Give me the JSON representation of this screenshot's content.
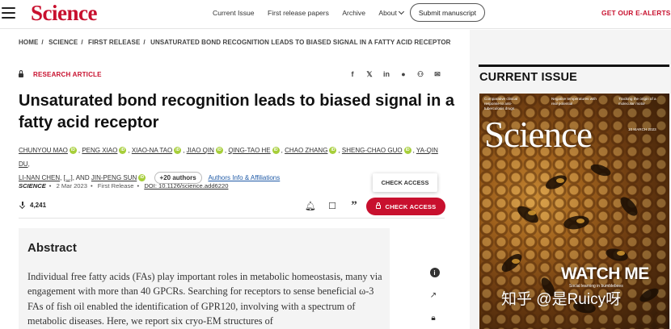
{
  "header": {
    "logo": "Science",
    "nav": [
      "Current Issue",
      "First release papers",
      "Archive",
      "About"
    ],
    "submit_label": "Submit manuscript",
    "ealerts_label": "GET OUR E-ALERTS"
  },
  "breadcrumb": [
    "HOME",
    "SCIENCE",
    "FIRST RELEASE",
    "UNSATURATED BOND RECOGNITION LEADS TO BIASED SIGNAL IN A FATTY ACID RECEPTOR"
  ],
  "article": {
    "type_label": "RESEARCH ARTICLE",
    "title": "Unsaturated bond recognition leads to biased signal in a fatty acid receptor",
    "authors": [
      "CHUNYOU MAO",
      "PENG XIAO",
      "XIAO-NA TAO",
      "JIAO QIN",
      "QING-TAO HE",
      "CHAO ZHANG",
      "SHENG-CHAO GUO",
      "YA-QIN DU",
      "LI-NAN CHEN"
    ],
    "authors_ellipsis": "[...]",
    "authors_and": ", AND",
    "last_author": "JIN-PENG SUN",
    "more_authors": "+20 authors",
    "affiliations_link": "Authors Info & Affiliations",
    "journal": "SCIENCE",
    "date": "2 Mar 2023",
    "release": "First Release",
    "doi": "DOI: 10.1126/science.add6220",
    "downloads": "4,241",
    "tooltip": "CHECK ACCESS",
    "access_label": "CHECK ACCESS"
  },
  "abstract": {
    "heading": "Abstract",
    "text": "Individual free fatty acids (FAs) play important roles in metabolic homeostasis, many via engagement with more than 40 GPCRs. Searching for receptors to sense beneficial ω-3 FAs of fish oil enabled the identification of GPR120, involving with a spectrum of metabolic diseases. Here, we report six cryo-EM structures of"
  },
  "sidebar": {
    "current_issue_label": "CURRENT ISSUE",
    "cover": {
      "logo": "Science",
      "teasers": [
        "Comparative clinical response to anti-tuberculosis drugs",
        "Negative temperatures with real potential",
        "Tracking the origin of a molecular motor"
      ],
      "date": "10 MARCH 2023",
      "watch_title": "WATCH ME",
      "watch_sub": "Social learning in bumblebees"
    }
  },
  "watermark": "知乎 @是Ruicy呀",
  "colors": {
    "brand_red": "#c8102e",
    "orcid_green": "#a6ce39",
    "panel_gray": "#f4f4f4"
  }
}
